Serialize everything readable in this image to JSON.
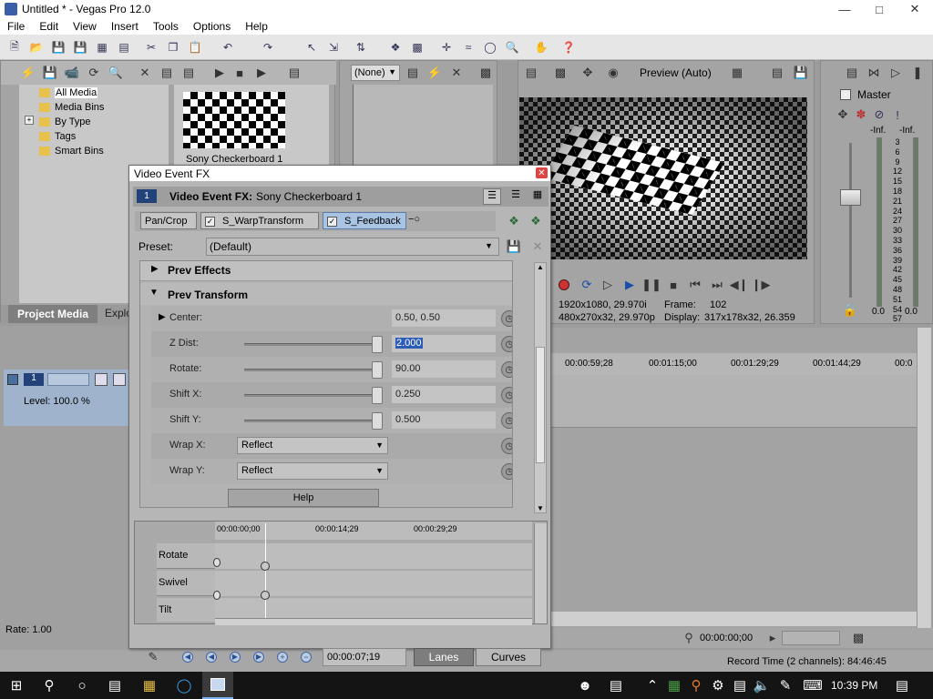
{
  "window": {
    "title": "Untitled * - Vegas Pro 12.0"
  },
  "menu": [
    "File",
    "Edit",
    "View",
    "Insert",
    "Tools",
    "Options",
    "Help"
  ],
  "media_tree": [
    "All Media",
    "Media Bins",
    "By Type",
    "Tags",
    "Smart Bins"
  ],
  "media_thumb_label": "Sony Checkerboard 1",
  "panel_tabs": {
    "project_media": "Project Media",
    "explorer": "Explo"
  },
  "track": {
    "level": "Level: 100.0 %",
    "number": "1"
  },
  "rate": "Rate: 1.00",
  "trimmer": {
    "combo": "(None)"
  },
  "preview": {
    "mode": "Preview (Auto)",
    "project_info": "1920x1080, 29.970i",
    "preview_info": "480x270x32, 29.970p",
    "frame_label": "Frame:",
    "frame_value": "102",
    "display_label": "Display:",
    "display_value": "317x178x32, 26.359"
  },
  "mixer": {
    "title": "Master",
    "inf_left": "-Inf.",
    "inf_right": "-Inf.",
    "scale": [
      "3",
      "6",
      "9",
      "12",
      "15",
      "18",
      "21",
      "24",
      "27",
      "30",
      "33",
      "36",
      "39",
      "42",
      "45",
      "48",
      "51",
      "54",
      "57"
    ],
    "bottom_left": "0.0",
    "bottom_right": "0.0"
  },
  "timeline": {
    "ticks": [
      "00:00:59;28",
      "00:01:15;00",
      "00:01:29;29",
      "00:01:44;29",
      "00:0"
    ],
    "cursor_time": "00:00:00;00",
    "record_time": "Record Time (2 channels): 84:46:45"
  },
  "fx": {
    "window_title": "Video Event FX",
    "event_label": "Video Event FX:",
    "event_name": "Sony Checkerboard 1",
    "track_num": "1",
    "chain": [
      "Pan/Crop",
      "S_WarpTransform",
      "S_Feedback"
    ],
    "preset_label": "Preset:",
    "preset_value": "(Default)",
    "sections": {
      "prev_effects": "Prev Effects",
      "prev_transform": "Prev Transform"
    },
    "params": {
      "center_label": "Center:",
      "center_value": "0.50, 0.50",
      "zdist_label": "Z Dist:",
      "zdist_value": "2.000",
      "rotate_label": "Rotate:",
      "rotate_value": "90.00",
      "shiftx_label": "Shift X:",
      "shiftx_value": "0.250",
      "shifty_label": "Shift Y:",
      "shifty_value": "0.500",
      "wrapx_label": "Wrap X:",
      "wrapx_value": "Reflect",
      "wrapy_label": "Wrap Y:",
      "wrapy_value": "Reflect"
    },
    "help": "Help",
    "keyframes": {
      "ticks": [
        "00:00:00;00",
        "00:00:14;29",
        "00:00:29;29"
      ],
      "tracks": [
        "Rotate",
        "Swivel",
        "Tilt"
      ]
    },
    "time_value": "00:00:07;19",
    "lanes": "Lanes",
    "curves": "Curves"
  },
  "taskbar": {
    "clock": "10:39 PM"
  }
}
